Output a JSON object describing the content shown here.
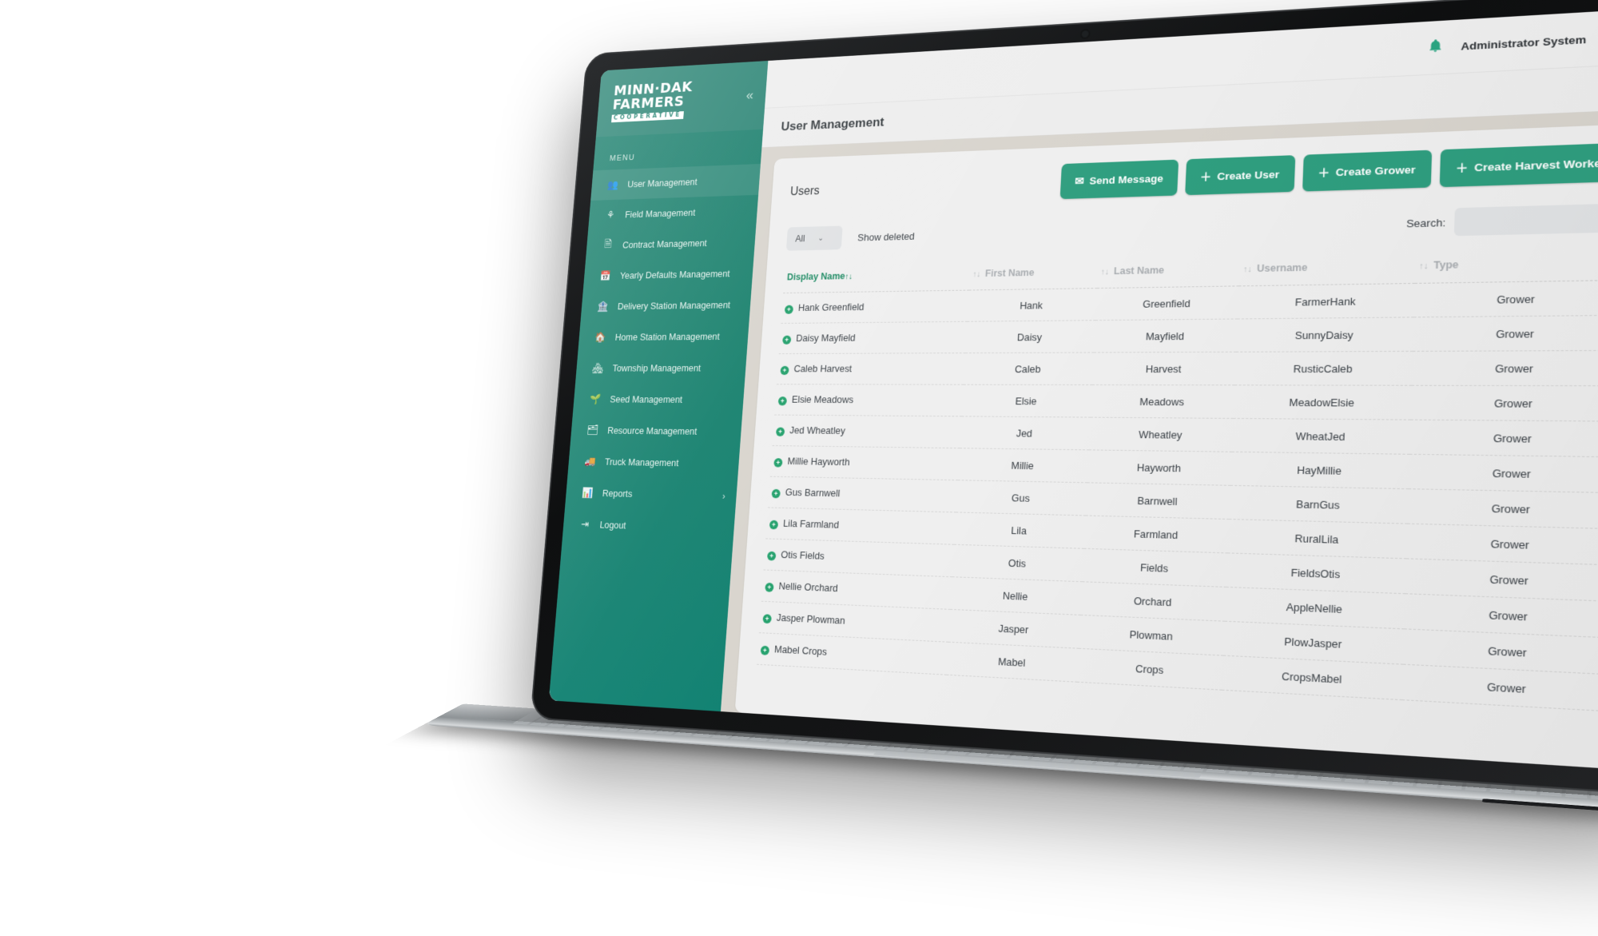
{
  "brand": {
    "line1": "MINN·DAK",
    "line2": "FARMERS",
    "line3": "COOPERATIVE",
    "collapse_icon": "«"
  },
  "sidebar": {
    "menu_label": "MENU",
    "items": [
      {
        "label": "User Management",
        "icon": "users-icon",
        "glyph": "👥",
        "active": true
      },
      {
        "label": "Field Management",
        "icon": "field-icon",
        "glyph": "⚘",
        "active": false
      },
      {
        "label": "Contract Management",
        "icon": "contract-icon",
        "glyph": "🗎",
        "active": false
      },
      {
        "label": "Yearly Defaults Management",
        "icon": "calendar-icon",
        "glyph": "📅",
        "active": false
      },
      {
        "label": "Delivery Station Management",
        "icon": "warehouse-icon",
        "glyph": "🏦",
        "active": false
      },
      {
        "label": "Home Station Management",
        "icon": "home-icon",
        "glyph": "🏠",
        "active": false
      },
      {
        "label": "Township Management",
        "icon": "buildings-icon",
        "glyph": "🏘",
        "active": false
      },
      {
        "label": "Seed Management",
        "icon": "seedling-icon",
        "glyph": "🌱",
        "active": false
      },
      {
        "label": "Resource Management",
        "icon": "resource-icon",
        "glyph": "🗂",
        "active": false
      },
      {
        "label": "Truck Management",
        "icon": "truck-icon",
        "glyph": "🚚",
        "active": false
      },
      {
        "label": "Reports",
        "icon": "chart-bar-icon",
        "glyph": "📊",
        "active": false,
        "caret": "›"
      },
      {
        "label": "Logout",
        "icon": "logout-icon",
        "glyph": "⇥",
        "active": false
      }
    ]
  },
  "topbar": {
    "bell_icon": "🔔",
    "user_name": "Administrator System",
    "avatar_icon": "tractor-icon"
  },
  "page": {
    "title": "User Management"
  },
  "card": {
    "title": "Users",
    "buttons": [
      {
        "label": "Send Message",
        "icon": "envelope-icon",
        "glyph": "✉"
      },
      {
        "label": "Create User",
        "icon": "plus-icon",
        "glyph": "＋"
      },
      {
        "label": "Create Grower",
        "icon": "plus-icon",
        "glyph": "＋"
      },
      {
        "label": "Create Harvest Worker",
        "icon": "plus-icon",
        "glyph": "＋"
      }
    ],
    "filter_value": "All",
    "filter_caret": "⌄",
    "show_deleted_label": "Show deleted",
    "search_label": "Search:",
    "search_value": "",
    "search_placeholder": ""
  },
  "table": {
    "sort_icon": "↑↓",
    "columns": [
      {
        "label": "Display Name",
        "sorted": true
      },
      {
        "label": "First Name",
        "sorted": false
      },
      {
        "label": "Last Name",
        "sorted": false
      },
      {
        "label": "Username",
        "sorted": false
      },
      {
        "label": "Type",
        "sorted": false
      }
    ],
    "status_glyph": "+",
    "rows": [
      {
        "display": "Hank Greenfield",
        "first": "Hank",
        "last": "Greenfield",
        "username": "FarmerHank",
        "type": "Grower"
      },
      {
        "display": "Daisy Mayfield",
        "first": "Daisy",
        "last": "Mayfield",
        "username": "SunnyDaisy",
        "type": "Grower"
      },
      {
        "display": "Caleb Harvest",
        "first": "Caleb",
        "last": "Harvest",
        "username": "RusticCaleb",
        "type": "Grower"
      },
      {
        "display": "Elsie Meadows",
        "first": "Elsie",
        "last": "Meadows",
        "username": "MeadowElsie",
        "type": "Grower"
      },
      {
        "display": "Jed Wheatley",
        "first": "Jed",
        "last": "Wheatley",
        "username": "WheatJed",
        "type": "Grower"
      },
      {
        "display": "Millie Hayworth",
        "first": "Millie",
        "last": "Hayworth",
        "username": "HayMillie",
        "type": "Grower"
      },
      {
        "display": "Gus Barnwell",
        "first": "Gus",
        "last": "Barnwell",
        "username": "BarnGus",
        "type": "Grower"
      },
      {
        "display": "Lila Farmland",
        "first": "Lila",
        "last": "Farmland",
        "username": "RuralLila",
        "type": "Grower"
      },
      {
        "display": "Otis Fields",
        "first": "Otis",
        "last": "Fields",
        "username": "FieldsOtis",
        "type": "Grower"
      },
      {
        "display": "Nellie Orchard",
        "first": "Nellie",
        "last": "Orchard",
        "username": "AppleNellie",
        "type": "Grower"
      },
      {
        "display": "Jasper Plowman",
        "first": "Jasper",
        "last": "Plowman",
        "username": "PlowJasper",
        "type": "Grower"
      },
      {
        "display": "Mabel Crops",
        "first": "Mabel",
        "last": "Crops",
        "username": "CropsMabel",
        "type": "Grower"
      }
    ]
  },
  "colors": {
    "brand_green": "#1c7f6d",
    "accent_green": "#2f9e7f",
    "sidebar_active": "#2f8a79",
    "status_dot": "#22a06b",
    "sorted_header": "#1c8a62"
  }
}
